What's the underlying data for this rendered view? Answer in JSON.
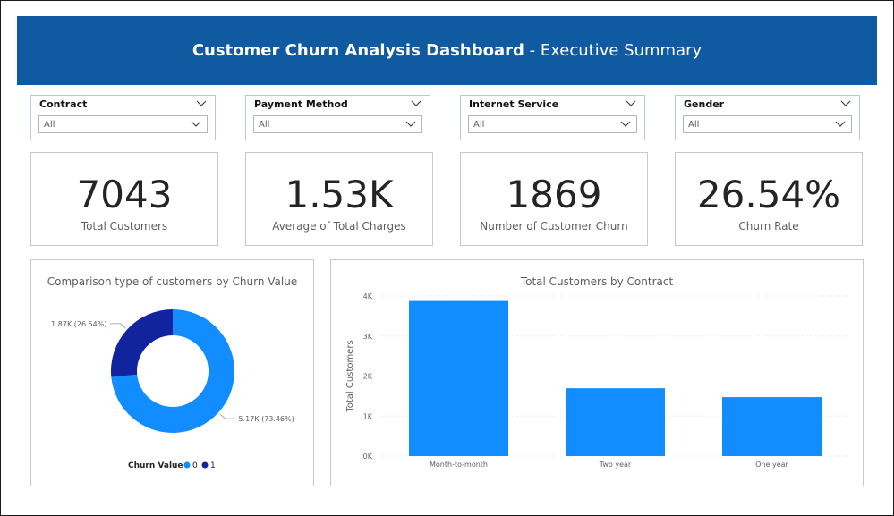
{
  "header": {
    "title_bold": "Customer Churn Analysis Dashboard",
    "title_rest": "- Executive Summary"
  },
  "slicers": [
    {
      "label": "Contract",
      "value": "All"
    },
    {
      "label": "Payment Method",
      "value": "All"
    },
    {
      "label": "Internet Service",
      "value": "All"
    },
    {
      "label": "Gender",
      "value": "All"
    }
  ],
  "cards": [
    {
      "value": "7043",
      "label": "Total Customers"
    },
    {
      "value": "1.53K",
      "label": "Average of Total Charges"
    },
    {
      "value": "1869",
      "label": "Number of Customer Churn"
    },
    {
      "value": "26.54%",
      "label": "Churn Rate"
    }
  ],
  "colors": {
    "header": "#0f5aa0",
    "series_0": "#118dff",
    "series_1": "#12239e"
  },
  "chart_data": [
    {
      "type": "pie",
      "title": "Comparison type of customers by Churn Value",
      "legend_title": "Churn Value",
      "legend_position": "bottom",
      "slices": [
        {
          "name": "0",
          "value": 5174,
          "label": "5.17K (73.46%)"
        },
        {
          "name": "1",
          "value": 1869,
          "label": "1.87K (26.54%)"
        }
      ]
    },
    {
      "type": "bar",
      "title": "Total Customers by Contract",
      "ylabel": "Total Customers",
      "xlabel": "",
      "categories": [
        "Month-to-month",
        "Two year",
        "One year"
      ],
      "values": [
        3875,
        1695,
        1473
      ],
      "ylim": [
        0,
        4000
      ],
      "y_ticks": [
        "0K",
        "1K",
        "2K",
        "3K",
        "4K"
      ],
      "grid": true
    }
  ]
}
